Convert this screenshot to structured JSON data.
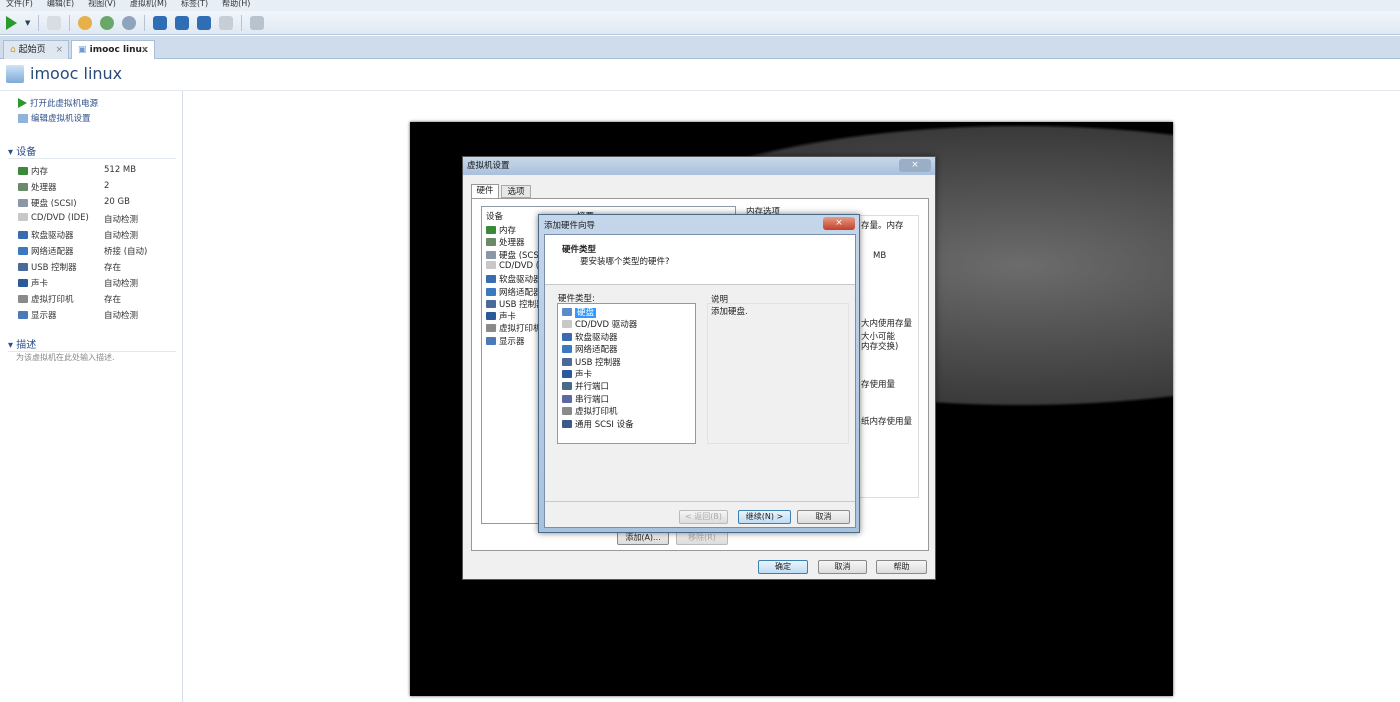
{
  "menu": [
    "文件(F)",
    "编辑(E)",
    "视图(V)",
    "虚拟机(M)",
    "标签(T)",
    "帮助(H)"
  ],
  "toolbar": {
    "icons": [
      "play-icon",
      "dropdown-icon",
      "send-keys-icon",
      "snapshot-icon",
      "revert-snapshot-icon",
      "snapshot-manager-icon",
      "show-sidebar-icon",
      "console-view-icon",
      "fullscreen-icon",
      "unity-icon",
      "thumbnail-icon"
    ]
  },
  "tabs": [
    {
      "label": "起始页",
      "icon": "home-icon"
    },
    {
      "label": "imooc linux",
      "icon": "vm-icon",
      "active": true
    }
  ],
  "vm": {
    "title": "imooc linux"
  },
  "actions": [
    "打开此虚拟机电源",
    "编辑虚拟机设置"
  ],
  "devices": {
    "header": "设备",
    "items": [
      {
        "name": "内存",
        "value": "512 MB",
        "icon": "memory-icon"
      },
      {
        "name": "处理器",
        "value": "2",
        "icon": "cpu-icon"
      },
      {
        "name": "硬盘 (SCSI)",
        "value": "20 GB",
        "icon": "harddisk-icon"
      },
      {
        "name": "CD/DVD (IDE)",
        "value": "自动检测",
        "icon": "cdrom-icon"
      },
      {
        "name": "软盘驱动器",
        "value": "自动检测",
        "icon": "floppy-icon"
      },
      {
        "name": "网络适配器",
        "value": "桥接 (自动)",
        "icon": "network-icon"
      },
      {
        "name": "USB 控制器",
        "value": "存在",
        "icon": "usb-icon"
      },
      {
        "name": "声卡",
        "value": "自动检测",
        "icon": "sound-icon"
      },
      {
        "name": "虚拟打印机",
        "value": "存在",
        "icon": "printer-icon"
      },
      {
        "name": "显示器",
        "value": "自动检测",
        "icon": "display-icon"
      }
    ]
  },
  "description": {
    "header": "描述",
    "placeholder": "为该虚拟机在此处输入描述."
  },
  "settings": {
    "title": "虚拟机设置",
    "close": "×",
    "tabs": [
      "硬件",
      "选项"
    ],
    "col_device": "设备",
    "col_summary": "摘要",
    "devices": [
      "内存",
      "处理器",
      "硬盘 (SCSI)",
      "CD/DVD (IDE)",
      "软盘驱动器",
      "网络适配器",
      "USB 控制器",
      "声卡",
      "虚拟打印机",
      "显示器"
    ],
    "memory_options": "内存选项",
    "fragments": [
      "存量。内存",
      "MB",
      "大内使用存量",
      "大小可能",
      "内存交换)",
      "存使用量",
      "纸内存使用量"
    ],
    "add": "添加(A)...",
    "remove": "移除(R)",
    "ok": "确定",
    "cancel": "取消",
    "help": "帮助"
  },
  "wizard": {
    "title": "添加硬件向导",
    "close": "×",
    "heading": "硬件类型",
    "subheading": "要安装哪个类型的硬件?",
    "list_label": "硬件类型:",
    "items": [
      "硬盘",
      "CD/DVD 驱动器",
      "软盘驱动器",
      "网络适配器",
      "USB 控制器",
      "声卡",
      "并行端口",
      "串行端口",
      "虚拟打印机",
      "通用 SCSI 设备"
    ],
    "selected": "硬盘",
    "desc_label": "说明",
    "desc": "添加硬盘.",
    "back": "< 返回(B)",
    "next": "继续(N) >",
    "cancel": "取消"
  }
}
